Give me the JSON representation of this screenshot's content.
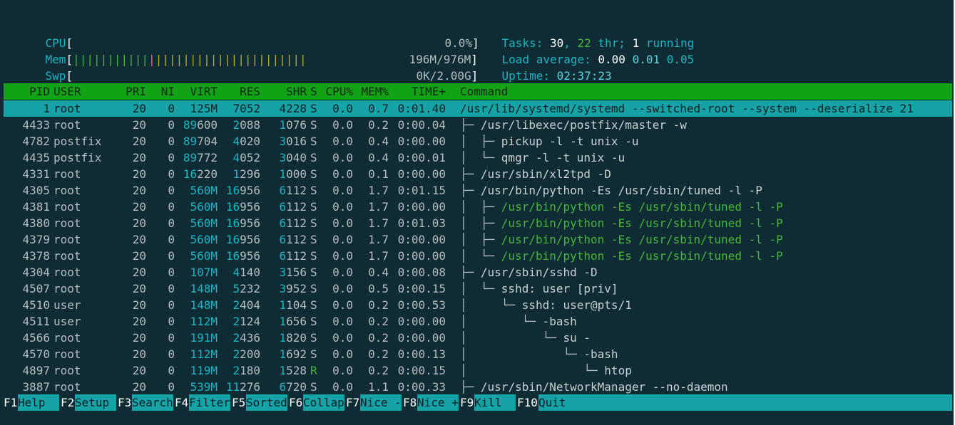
{
  "meters": {
    "cpu": {
      "label": "CPU",
      "bar": "",
      "value": "0.0%"
    },
    "mem": {
      "label": "Mem",
      "bar_green": "|||||||||||",
      "bar_pink": "|",
      "bar_yellow": "||||||||||||||||||||||",
      "value": "196M/976M"
    },
    "swp": {
      "label": "Swp",
      "bar": "",
      "value": "0K/2.00G"
    }
  },
  "info": {
    "tasks_label": "Tasks: ",
    "tasks_count": "30",
    "comma": ", ",
    "threads_count": "22",
    "threads_label": " thr; ",
    "running_count": "1",
    "running_label": " running",
    "load_label": "Load average: ",
    "load1": "0.00",
    "load5": "0.01",
    "load15": "0.05",
    "uptime_label": "Uptime: ",
    "uptime": "02:37:23"
  },
  "columns": [
    "PID",
    "USER",
    "PRI",
    "NI",
    "VIRT",
    "RES",
    "SHR",
    "S",
    "CPU%",
    "MEM%",
    "TIME+",
    "Command"
  ],
  "rows": [
    {
      "pid": "1",
      "user": "root",
      "pri": "20",
      "ni": "0",
      "virt": "125M",
      "res": "7052",
      "shr": "4228",
      "s": "S",
      "cpu": "0.0",
      "mem": "0.7",
      "time": "0:01.40",
      "tree": "",
      "cmd": "/usr/lib/systemd/systemd --switched-root --system --deserialize 21",
      "thread": false,
      "selected": true
    },
    {
      "pid": "4433",
      "user": "root",
      "pri": "20",
      "ni": "0",
      "virt": "89600",
      "res": "2088",
      "shr": "1076",
      "s": "S",
      "cpu": "0.0",
      "mem": "0.2",
      "time": "0:00.04",
      "tree": "├─ ",
      "cmd": "/usr/libexec/postfix/master -w",
      "thread": false,
      "selected": false
    },
    {
      "pid": "4782",
      "user": "postfix",
      "pri": "20",
      "ni": "0",
      "virt": "89704",
      "res": "4020",
      "shr": "3016",
      "s": "S",
      "cpu": "0.0",
      "mem": "0.4",
      "time": "0:00.00",
      "tree": "│  ├─ ",
      "cmd": "pickup -l -t unix -u",
      "thread": false,
      "selected": false
    },
    {
      "pid": "4435",
      "user": "postfix",
      "pri": "20",
      "ni": "0",
      "virt": "89772",
      "res": "4052",
      "shr": "3040",
      "s": "S",
      "cpu": "0.0",
      "mem": "0.4",
      "time": "0:00.01",
      "tree": "│  └─ ",
      "cmd": "qmgr -l -t unix -u",
      "thread": false,
      "selected": false
    },
    {
      "pid": "4331",
      "user": "root",
      "pri": "20",
      "ni": "0",
      "virt": "16220",
      "res": "1296",
      "shr": "1000",
      "s": "S",
      "cpu": "0.0",
      "mem": "0.1",
      "time": "0:00.00",
      "tree": "├─ ",
      "cmd": "/usr/sbin/xl2tpd -D",
      "thread": false,
      "selected": false
    },
    {
      "pid": "4305",
      "user": "root",
      "pri": "20",
      "ni": "0",
      "virt": "560M",
      "res": "16956",
      "shr": "6112",
      "s": "S",
      "cpu": "0.0",
      "mem": "1.7",
      "time": "0:01.15",
      "tree": "├─ ",
      "cmd": "/usr/bin/python -Es /usr/sbin/tuned -l -P",
      "thread": false,
      "selected": false
    },
    {
      "pid": "4381",
      "user": "root",
      "pri": "20",
      "ni": "0",
      "virt": "560M",
      "res": "16956",
      "shr": "6112",
      "s": "S",
      "cpu": "0.0",
      "mem": "1.7",
      "time": "0:00.00",
      "tree": "│  ├─ ",
      "cmd": "/usr/bin/python -Es /usr/sbin/tuned -l -P",
      "thread": true,
      "selected": false
    },
    {
      "pid": "4380",
      "user": "root",
      "pri": "20",
      "ni": "0",
      "virt": "560M",
      "res": "16956",
      "shr": "6112",
      "s": "S",
      "cpu": "0.0",
      "mem": "1.7",
      "time": "0:01.03",
      "tree": "│  ├─ ",
      "cmd": "/usr/bin/python -Es /usr/sbin/tuned -l -P",
      "thread": true,
      "selected": false
    },
    {
      "pid": "4379",
      "user": "root",
      "pri": "20",
      "ni": "0",
      "virt": "560M",
      "res": "16956",
      "shr": "6112",
      "s": "S",
      "cpu": "0.0",
      "mem": "1.7",
      "time": "0:00.00",
      "tree": "│  ├─ ",
      "cmd": "/usr/bin/python -Es /usr/sbin/tuned -l -P",
      "thread": true,
      "selected": false
    },
    {
      "pid": "4378",
      "user": "root",
      "pri": "20",
      "ni": "0",
      "virt": "560M",
      "res": "16956",
      "shr": "6112",
      "s": "S",
      "cpu": "0.0",
      "mem": "1.7",
      "time": "0:00.00",
      "tree": "│  └─ ",
      "cmd": "/usr/bin/python -Es /usr/sbin/tuned -l -P",
      "thread": true,
      "selected": false
    },
    {
      "pid": "4304",
      "user": "root",
      "pri": "20",
      "ni": "0",
      "virt": "107M",
      "res": "4140",
      "shr": "3156",
      "s": "S",
      "cpu": "0.0",
      "mem": "0.4",
      "time": "0:00.08",
      "tree": "├─ ",
      "cmd": "/usr/sbin/sshd -D",
      "thread": false,
      "selected": false
    },
    {
      "pid": "4507",
      "user": "root",
      "pri": "20",
      "ni": "0",
      "virt": "148M",
      "res": "5232",
      "shr": "3952",
      "s": "S",
      "cpu": "0.0",
      "mem": "0.5",
      "time": "0:00.15",
      "tree": "│  └─ ",
      "cmd": "sshd: user [priv]",
      "thread": false,
      "selected": false
    },
    {
      "pid": "4510",
      "user": "user",
      "pri": "20",
      "ni": "0",
      "virt": "148M",
      "res": "2404",
      "shr": "1104",
      "s": "S",
      "cpu": "0.0",
      "mem": "0.2",
      "time": "0:00.53",
      "tree": "│     └─ ",
      "cmd": "sshd: user@pts/1",
      "thread": false,
      "selected": false
    },
    {
      "pid": "4511",
      "user": "user",
      "pri": "20",
      "ni": "0",
      "virt": "112M",
      "res": "2124",
      "shr": "1656",
      "s": "S",
      "cpu": "0.0",
      "mem": "0.2",
      "time": "0:00.00",
      "tree": "│        └─ ",
      "cmd": "-bash",
      "thread": false,
      "selected": false
    },
    {
      "pid": "4566",
      "user": "root",
      "pri": "20",
      "ni": "0",
      "virt": "191M",
      "res": "2436",
      "shr": "1820",
      "s": "S",
      "cpu": "0.0",
      "mem": "0.2",
      "time": "0:00.00",
      "tree": "│           └─ ",
      "cmd": "su -",
      "thread": false,
      "selected": false
    },
    {
      "pid": "4570",
      "user": "root",
      "pri": "20",
      "ni": "0",
      "virt": "112M",
      "res": "2200",
      "shr": "1692",
      "s": "S",
      "cpu": "0.0",
      "mem": "0.2",
      "time": "0:00.13",
      "tree": "│              └─ ",
      "cmd": "-bash",
      "thread": false,
      "selected": false
    },
    {
      "pid": "4897",
      "user": "root",
      "pri": "20",
      "ni": "0",
      "virt": "119M",
      "res": "2180",
      "shr": "1528",
      "s": "R",
      "cpu": "0.0",
      "mem": "0.2",
      "time": "0:00.15",
      "tree": "│                 └─ ",
      "cmd": "htop",
      "thread": false,
      "selected": false
    },
    {
      "pid": "3887",
      "user": "root",
      "pri": "20",
      "ni": "0",
      "virt": "539M",
      "res": "11276",
      "shr": "6720",
      "s": "S",
      "cpu": "0.0",
      "mem": "1.1",
      "time": "0:00.33",
      "tree": "├─ ",
      "cmd": "/usr/sbin/NetworkManager --no-daemon",
      "thread": false,
      "selected": false
    }
  ],
  "footer": [
    {
      "key": "F1",
      "label": "Help  "
    },
    {
      "key": "F2",
      "label": "Setup "
    },
    {
      "key": "F3",
      "label": "Search"
    },
    {
      "key": "F4",
      "label": "Filter"
    },
    {
      "key": "F5",
      "label": "Sorted"
    },
    {
      "key": "F6",
      "label": "Collap"
    },
    {
      "key": "F7",
      "label": "Nice -"
    },
    {
      "key": "F8",
      "label": "Nice +"
    },
    {
      "key": "F9",
      "label": "Kill  "
    },
    {
      "key": "F10",
      "label": "Quit"
    }
  ],
  "colors": {
    "background": "#0f2b33",
    "header_bg": "#12a215",
    "selected_bg": "#15a3a8",
    "cyan": "#1bb5c4",
    "green": "#46b43a"
  }
}
